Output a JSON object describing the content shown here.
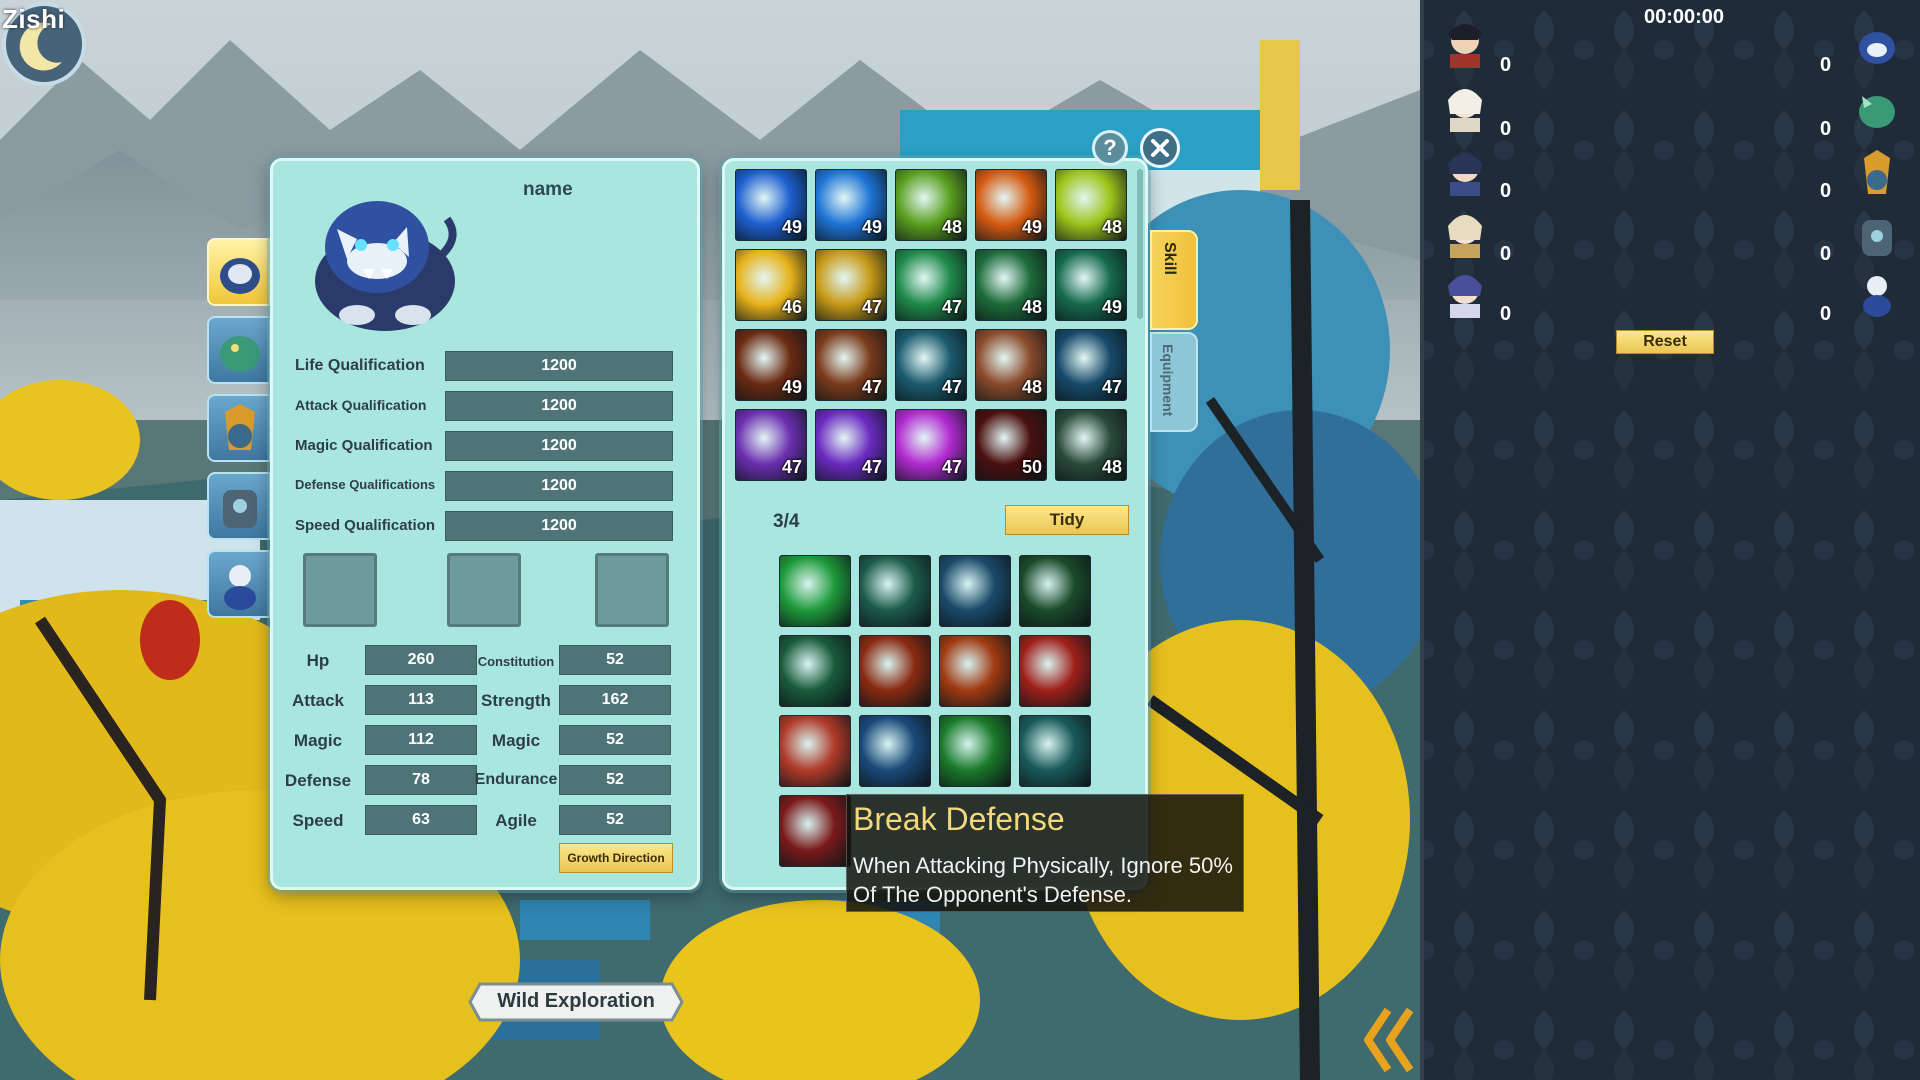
{
  "moon_label": "Zishi",
  "pet": {
    "name": "name",
    "qualifications": [
      {
        "label": "Life Qualification",
        "value": "1200"
      },
      {
        "label": "Attack Qualification",
        "value": "1200"
      },
      {
        "label": "Magic Qualification",
        "value": "1200"
      },
      {
        "label": "Defense Qualifications",
        "value": "1200"
      },
      {
        "label": "Speed Qualification",
        "value": "1200"
      }
    ],
    "stats_left": [
      {
        "label": "Hp",
        "value": "260"
      },
      {
        "label": "Attack",
        "value": "113"
      },
      {
        "label": "Magic",
        "value": "112"
      },
      {
        "label": "Defense",
        "value": "78"
      },
      {
        "label": "Speed",
        "value": "63"
      }
    ],
    "stats_right": [
      {
        "label": "Constitution",
        "value": "52"
      },
      {
        "label": "Strength",
        "value": "162"
      },
      {
        "label": "Magic",
        "value": "52"
      },
      {
        "label": "Endurance",
        "value": "52"
      },
      {
        "label": "Agile",
        "value": "52"
      }
    ],
    "growth_button": "Growth Direction"
  },
  "skills": {
    "levels": [
      "49",
      "49",
      "48",
      "49",
      "48",
      "46",
      "47",
      "47",
      "48",
      "49",
      "49",
      "47",
      "47",
      "48",
      "47",
      "47",
      "47",
      "47",
      "50",
      "48"
    ],
    "colors": [
      "#1d5fd0",
      "#1e74d6",
      "#5a9e1e",
      "#d45a10",
      "#9cc41a",
      "#e7b21b",
      "#c79a18",
      "#1f8a4a",
      "#1d6b3a",
      "#166a4e",
      "#6a2a12",
      "#7a3a1a",
      "#1b5a6e",
      "#8a4a2a",
      "#174a6a",
      "#6b2fb0",
      "#6a2ac0",
      "#b12ad0",
      "#4a1010",
      "#2a4a3a"
    ],
    "equipped_count": "3/4",
    "tidy_button": "Tidy",
    "equipped_colors": [
      "#1f9a3a",
      "#1d5a4a",
      "#1b4a6a",
      "#1a4a2a",
      "#1a5a3a",
      "#8a2a12",
      "#a03a12",
      "#a0201a",
      "#b03a2a",
      "#1a4a7a",
      "#1a7a2a",
      "#1a5a5a",
      "#7a1a1a"
    ]
  },
  "tabs": {
    "skill": "Skill",
    "equipment": "Equipment"
  },
  "tooltip": {
    "title": "Break Defense",
    "description": "When Attacking Physically, Ignore 50% Of The Opponent's Defense."
  },
  "wild_exploration": "Wild Exploration",
  "scoreboard": {
    "timer": "00:00:00",
    "left_scores": [
      "0",
      "0",
      "0",
      "0",
      "0"
    ],
    "right_scores": [
      "0",
      "0",
      "0",
      "0",
      "0"
    ],
    "reset_button": "Reset"
  }
}
